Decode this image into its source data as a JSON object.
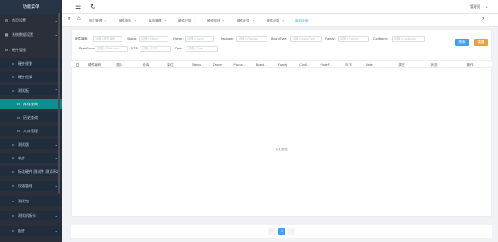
{
  "sidebar": {
    "title": "功能菜单",
    "items": [
      {
        "label": "首页设置"
      },
      {
        "label": "系统数据设置"
      },
      {
        "label": "硬件管理"
      },
      {
        "label": "硬件规划"
      },
      {
        "label": "硬件纪录"
      },
      {
        "label": "测试板"
      },
      {
        "label": "库存查询"
      },
      {
        "label": "历史查询"
      },
      {
        "label": "入库管理"
      },
      {
        "label": "测试版"
      },
      {
        "label": "软件"
      },
      {
        "label": "标准硬件 测试件 测试环境"
      },
      {
        "label": "仪器管理"
      },
      {
        "label": "测试包"
      },
      {
        "label": "测试机板卡"
      },
      {
        "label": "配件"
      }
    ]
  },
  "topbar": {
    "user_label": "管理员"
  },
  "tabs": [
    {
      "label": "部门管理"
    },
    {
      "label": "硬件规划"
    },
    {
      "label": "库存管理"
    },
    {
      "label": "硬件纪录"
    },
    {
      "label": "硬件规划"
    },
    {
      "label": "硬件纪录"
    },
    {
      "label": "硬件纪录"
    },
    {
      "label": "库存查询"
    }
  ],
  "filters": {
    "row1": [
      {
        "label": "硬件编码:",
        "placeholder": "请输入硬件编码"
      },
      {
        "label": "Status:",
        "placeholder": "请输入Status"
      },
      {
        "label": "Owner:",
        "placeholder": "请输入Owner"
      },
      {
        "label": "Package:",
        "placeholder": "请输入Package"
      },
      {
        "label": "BoardType:",
        "placeholder": "请输入BoardType"
      },
      {
        "label": "Family:",
        "placeholder": "请输入Family"
      },
      {
        "label": "ConfigInfo:",
        "placeholder": "请输入ConfigInfo"
      }
    ],
    "row2": [
      {
        "label": "PlateForm:",
        "placeholder": "请输入PlateForm"
      },
      {
        "label": "SITE:",
        "placeholder": "请输入SITE"
      },
      {
        "label": "Date:",
        "placeholder": "请输入Date"
      }
    ],
    "search_label": "搜索",
    "reset_label": "重置"
  },
  "table": {
    "columns": [
      "硬件编码",
      "图片",
      "仓库",
      "库位",
      "Status",
      "Owner",
      "Packa...",
      "Board...",
      "Family",
      "Confi...",
      "PlateF...",
      "SITE",
      "Date",
      "类型",
      "状态",
      "操作"
    ],
    "empty_text": "暂无数据"
  },
  "pagination": {
    "current_page": "1"
  },
  "colors": {
    "sidebar_bg": "#2b2f3a",
    "active_teal": "#0e8f8f",
    "search_blue": "#409eff",
    "reset_orange": "#e6a23c"
  }
}
